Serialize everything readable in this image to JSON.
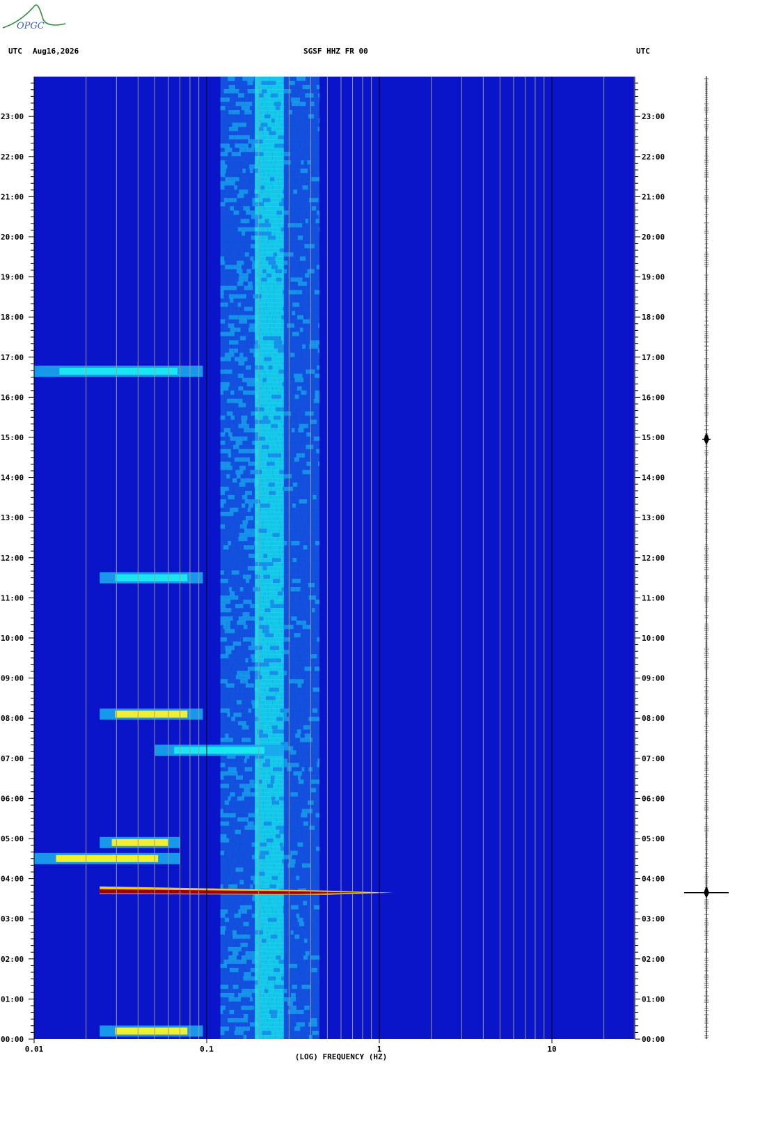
{
  "header": {
    "left_tz": "UTC",
    "date": "Aug16,2026",
    "station": "SGSF HHZ FR 00",
    "right_tz": "UTC"
  },
  "logo": {
    "text": "OPGC"
  },
  "colors": {
    "background_blue": "#0a14c8",
    "cyan": "#19e6f0",
    "yellow": "#f0f032",
    "red": "#a00000",
    "grid_line": "#9a9a9a"
  },
  "chart_data": {
    "type": "heatmap",
    "title": "",
    "xlabel": "(LOG) FREQUENCY (HZ)",
    "ylabel": "",
    "x_scale": "log",
    "xlim": [
      0.01,
      30
    ],
    "x_tick_labels": [
      {
        "value": 0.01,
        "label": "0.01"
      },
      {
        "value": 0.1,
        "label": "0.1"
      },
      {
        "value": 1,
        "label": "1"
      },
      {
        "value": 10,
        "label": "10"
      }
    ],
    "ylim_hours": [
      0,
      24
    ],
    "y_tick_labels": [
      "00:00",
      "01:00",
      "02:00",
      "03:00",
      "04:00",
      "05:00",
      "06:00",
      "07:00",
      "08:00",
      "09:00",
      "10:00",
      "11:00",
      "12:00",
      "13:00",
      "14:00",
      "15:00",
      "16:00",
      "17:00",
      "18:00",
      "19:00",
      "20:00",
      "21:00",
      "22:00",
      "23:00"
    ],
    "background_noise_band": {
      "f_low": 0.12,
      "f_peak_low": 0.2,
      "f_peak_high": 0.28,
      "f_high": 0.45
    },
    "events": [
      {
        "time_h": 3.65,
        "f_low": 0.024,
        "f_high": 1.2,
        "level": "red"
      },
      {
        "time_h": 0.2,
        "f_low": 0.024,
        "f_high": 0.095,
        "level": "yellow"
      },
      {
        "time_h": 4.5,
        "f_low": 0.01,
        "f_high": 0.07,
        "level": "yellow"
      },
      {
        "time_h": 4.9,
        "f_low": 0.024,
        "f_high": 0.07,
        "level": "yellow"
      },
      {
        "time_h": 7.2,
        "f_low": 0.05,
        "f_high": 0.28,
        "level": "cyan"
      },
      {
        "time_h": 8.1,
        "f_low": 0.024,
        "f_high": 0.095,
        "level": "yellow"
      },
      {
        "time_h": 11.5,
        "f_low": 0.024,
        "f_high": 0.095,
        "level": "cyan"
      },
      {
        "time_h": 16.65,
        "f_low": 0.01,
        "f_high": 0.095,
        "level": "cyan"
      }
    ],
    "seismogram_spikes_h": [
      3.65,
      14.95
    ]
  }
}
